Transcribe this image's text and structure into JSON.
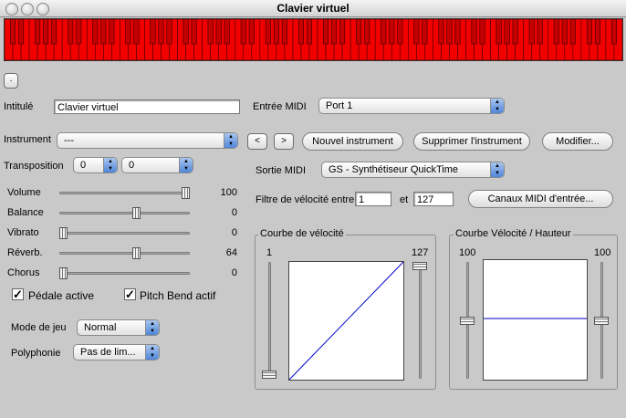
{
  "window": {
    "title": "Clavier virtuel"
  },
  "small_button_label": "·",
  "intitule": {
    "label": "Intitulé",
    "value": "Clavier virtuel"
  },
  "entree_midi": {
    "label": "Entrée MIDI",
    "value": "Port 1"
  },
  "instrument": {
    "label": "Instrument",
    "value": "---",
    "prev_label": "<",
    "next_label": ">"
  },
  "buttons": {
    "nouvel": "Nouvel instrument",
    "supprimer": "Supprimer l'instrument",
    "modifier": "Modifier...",
    "canaux": "Canaux MIDI d'entrée..."
  },
  "transposition": {
    "label": "Transposition",
    "value1": "0",
    "value2": "0"
  },
  "sortie_midi": {
    "label": "Sortie MIDI",
    "value": "GS - Synthétiseur QuickTime"
  },
  "filtre": {
    "label": "Filtre de vélocité entre",
    "min": "1",
    "and_label": "et",
    "max": "127"
  },
  "sliders": [
    {
      "label": "Volume",
      "value": "100",
      "level": 1.0
    },
    {
      "label": "Balance",
      "value": "0",
      "level": 0.6
    },
    {
      "label": "Vibrato",
      "value": "0",
      "level": 0.0
    },
    {
      "label": "Réverb.",
      "value": "64",
      "level": 0.6
    },
    {
      "label": "Chorus",
      "value": "0",
      "level": 0.0
    }
  ],
  "checkboxes": {
    "pedale": "Pédale active",
    "pitch_bend": "Pitch Bend actif"
  },
  "mode_jeu": {
    "label": "Mode de jeu",
    "value": "Normal"
  },
  "polyphonie": {
    "label": "Polyphonie",
    "value": "Pas de lim..."
  },
  "courbe_velocite": {
    "title": "Courbe de vélocité",
    "left_value": "1",
    "right_value": "127",
    "left_level": 0.0,
    "right_level": 1.0
  },
  "courbe_hauteur": {
    "title": "Courbe Vélocité / Hauteur",
    "left_value": "100",
    "right_value": "100",
    "left_level": 0.5,
    "right_level": 0.5
  },
  "colors": {
    "keyboard": "#f20000",
    "curve": "#0000cc",
    "popup_arrow": "#4f86d9"
  }
}
